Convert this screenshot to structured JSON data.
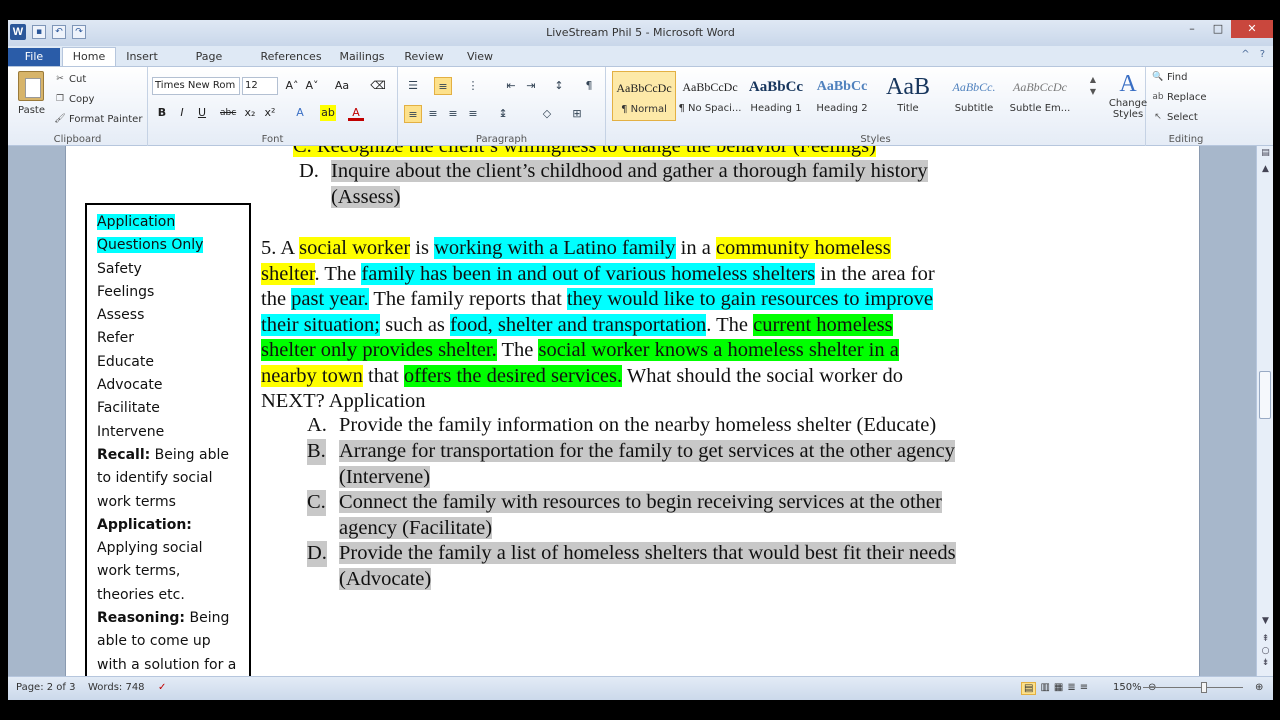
{
  "window": {
    "title": "LiveStream Phil 5 - Microsoft Word"
  },
  "tabs": [
    "File",
    "Home",
    "Insert",
    "Page Layout",
    "References",
    "Mailings",
    "Review",
    "View"
  ],
  "clipboard": {
    "paste": "Paste",
    "cut": "Cut",
    "copy": "Copy",
    "format_painter": "Format Painter",
    "label": "Clipboard"
  },
  "font": {
    "name": "Times New Rom",
    "size": "12",
    "label": "Font"
  },
  "paragraph": {
    "label": "Paragraph"
  },
  "styles": {
    "label": "Styles",
    "items": [
      {
        "preview": "AaBbCcDc",
        "name": "¶ Normal"
      },
      {
        "preview": "AaBbCcDc",
        "name": "¶ No Spaci..."
      },
      {
        "preview": "AaBbCc",
        "name": "Heading 1"
      },
      {
        "preview": "AaBbCc",
        "name": "Heading 2"
      },
      {
        "preview": "AaB",
        "name": "Title"
      },
      {
        "preview": "AaBbCc.",
        "name": "Subtitle"
      },
      {
        "preview": "AaBbCcDc",
        "name": "Subtle Em..."
      }
    ],
    "change": "Change Styles"
  },
  "editing": {
    "label": "Editing",
    "find": "Find",
    "replace": "Replace",
    "select": "Select"
  },
  "sidebox": {
    "heading1": "Application",
    "heading2": "Questions Only",
    "items": [
      "Safety",
      "Feelings",
      "Assess",
      "Refer",
      "Educate",
      "Advocate",
      "Facilitate",
      "Intervene"
    ],
    "recall_b": "Recall:",
    "recall_t": " Being able to identify social work terms",
    "app_b": "Application:",
    "app_t": " Applying social work terms, theories etc.",
    "reason_b": "Reasoning:",
    "reason_t": " Being able to come up with a solution for a"
  },
  "doc": {
    "prev_top": "C.   Recognize the client’s willingness to change the behavior (Feelings)",
    "prev_d_letter": "D.",
    "prev_d1": "Inquire about the client’s childhood and gather a thorough family history",
    "prev_d2": "(Assess)",
    "q": {
      "s1": "5. A ",
      "s2": "social worker",
      "s3": " is ",
      "s4": "working with a Latino family",
      "s5": " in a ",
      "s6": "community homeless",
      "s7": "shelter",
      "s8": ". The ",
      "s9": "family has been in and out of various homeless shelters",
      "s10": " in the area for",
      "s11": "the ",
      "s12": "past year.",
      "s13": " The family reports that ",
      "s14": "they would like to gain resources to improve",
      "s15": "their situation;",
      "s16": " such as ",
      "s17": "food, shelter and transportation",
      "s18": ". The ",
      "s19": "current homeless",
      "s20": "shelter only provides shelter.",
      "s21": " The ",
      "s22": "social worker knows a homeless shelter in a",
      "s23": "nearby town",
      "s24": " that ",
      "s25": "offers the desired services.",
      "s26": " What should the social worker do",
      "s27": "NEXT? Application"
    },
    "answers": [
      {
        "letter": "A.",
        "l1": "Provide the family information on the nearby homeless shelter  (Educate)",
        "l2": ""
      },
      {
        "letter": "B.",
        "l1": "Arrange for transportation for the family to get services at the other agency",
        "l2": "(Intervene)"
      },
      {
        "letter": "C.",
        "l1": "Connect the family with resources to begin receiving services at the other",
        "l2": "agency (Facilitate)"
      },
      {
        "letter": "D.",
        "l1": "Provide the family a list of homeless shelters that would best fit their needs",
        "l2": "(Advocate)"
      }
    ]
  },
  "status": {
    "page": "Page: 2 of 3",
    "words": "Words: 748",
    "zoom": "150%"
  }
}
